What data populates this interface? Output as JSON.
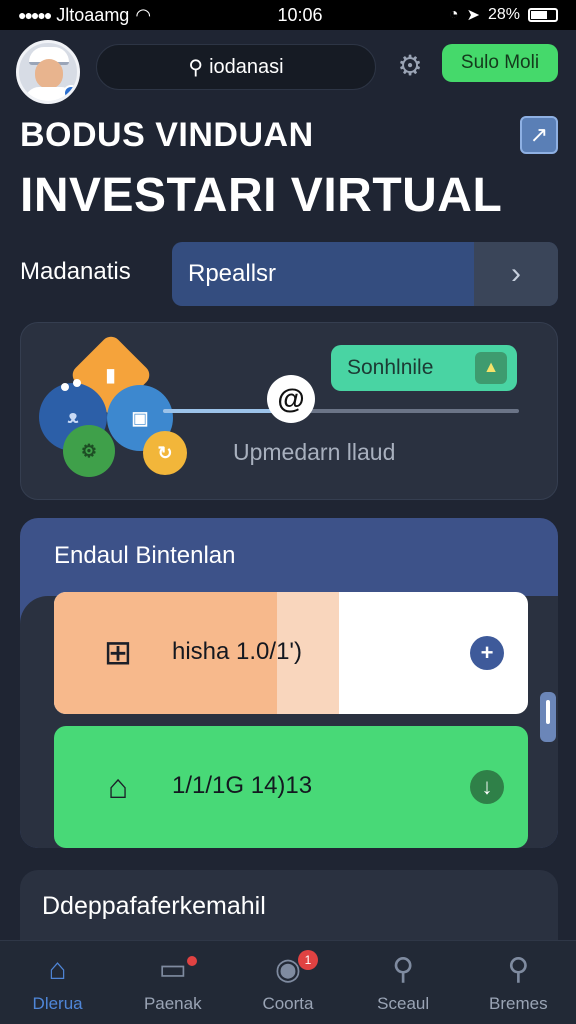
{
  "status_bar": {
    "carrier": "Jltoaamg",
    "time": "10:06",
    "battery": "28%",
    "level_fraction": 0.6
  },
  "header": {
    "search_text": "iodanasi",
    "cta_label": "Sulo Moli"
  },
  "titles": {
    "small": "BODUS VINDUAN",
    "large": "INVESTARI VIRTUAL"
  },
  "filter": {
    "label": "Madanatis",
    "value": "Rpeallsr"
  },
  "connect_card": {
    "pill_label": "Sonhlnile",
    "caption": "Upmedarn llaud",
    "progress_fraction": 0.36,
    "knob_glyph": "@"
  },
  "list_card": {
    "title": "Endaul Bintenlan",
    "rows": [
      {
        "text": "hisha 1.0/1')",
        "action": "+",
        "fill_fraction": 0.47
      },
      {
        "text": "1/1/1G 14)13",
        "action": "↓"
      }
    ]
  },
  "dept_card": {
    "title": "Ddeppafaferkemahil"
  },
  "tabs": [
    {
      "label": "Dlerua",
      "icon": "home-icon",
      "glyph": "⌂",
      "active": true
    },
    {
      "label": "Paenak",
      "icon": "card-icon",
      "glyph": "▭",
      "active": false
    },
    {
      "label": "Coorta",
      "icon": "chat-icon",
      "glyph": "◉",
      "active": false,
      "badge": "1"
    },
    {
      "label": "Sceaul",
      "icon": "search-icon",
      "glyph": "⚲",
      "active": false
    },
    {
      "label": "Bremes",
      "icon": "search-icon",
      "glyph": "⚲",
      "active": false
    }
  ],
  "colors": {
    "background": "#1f2533",
    "accent_green": "#45d96b",
    "accent_blue": "#344d7f",
    "teal": "#49d4a3",
    "peach": "#f7b98c"
  }
}
